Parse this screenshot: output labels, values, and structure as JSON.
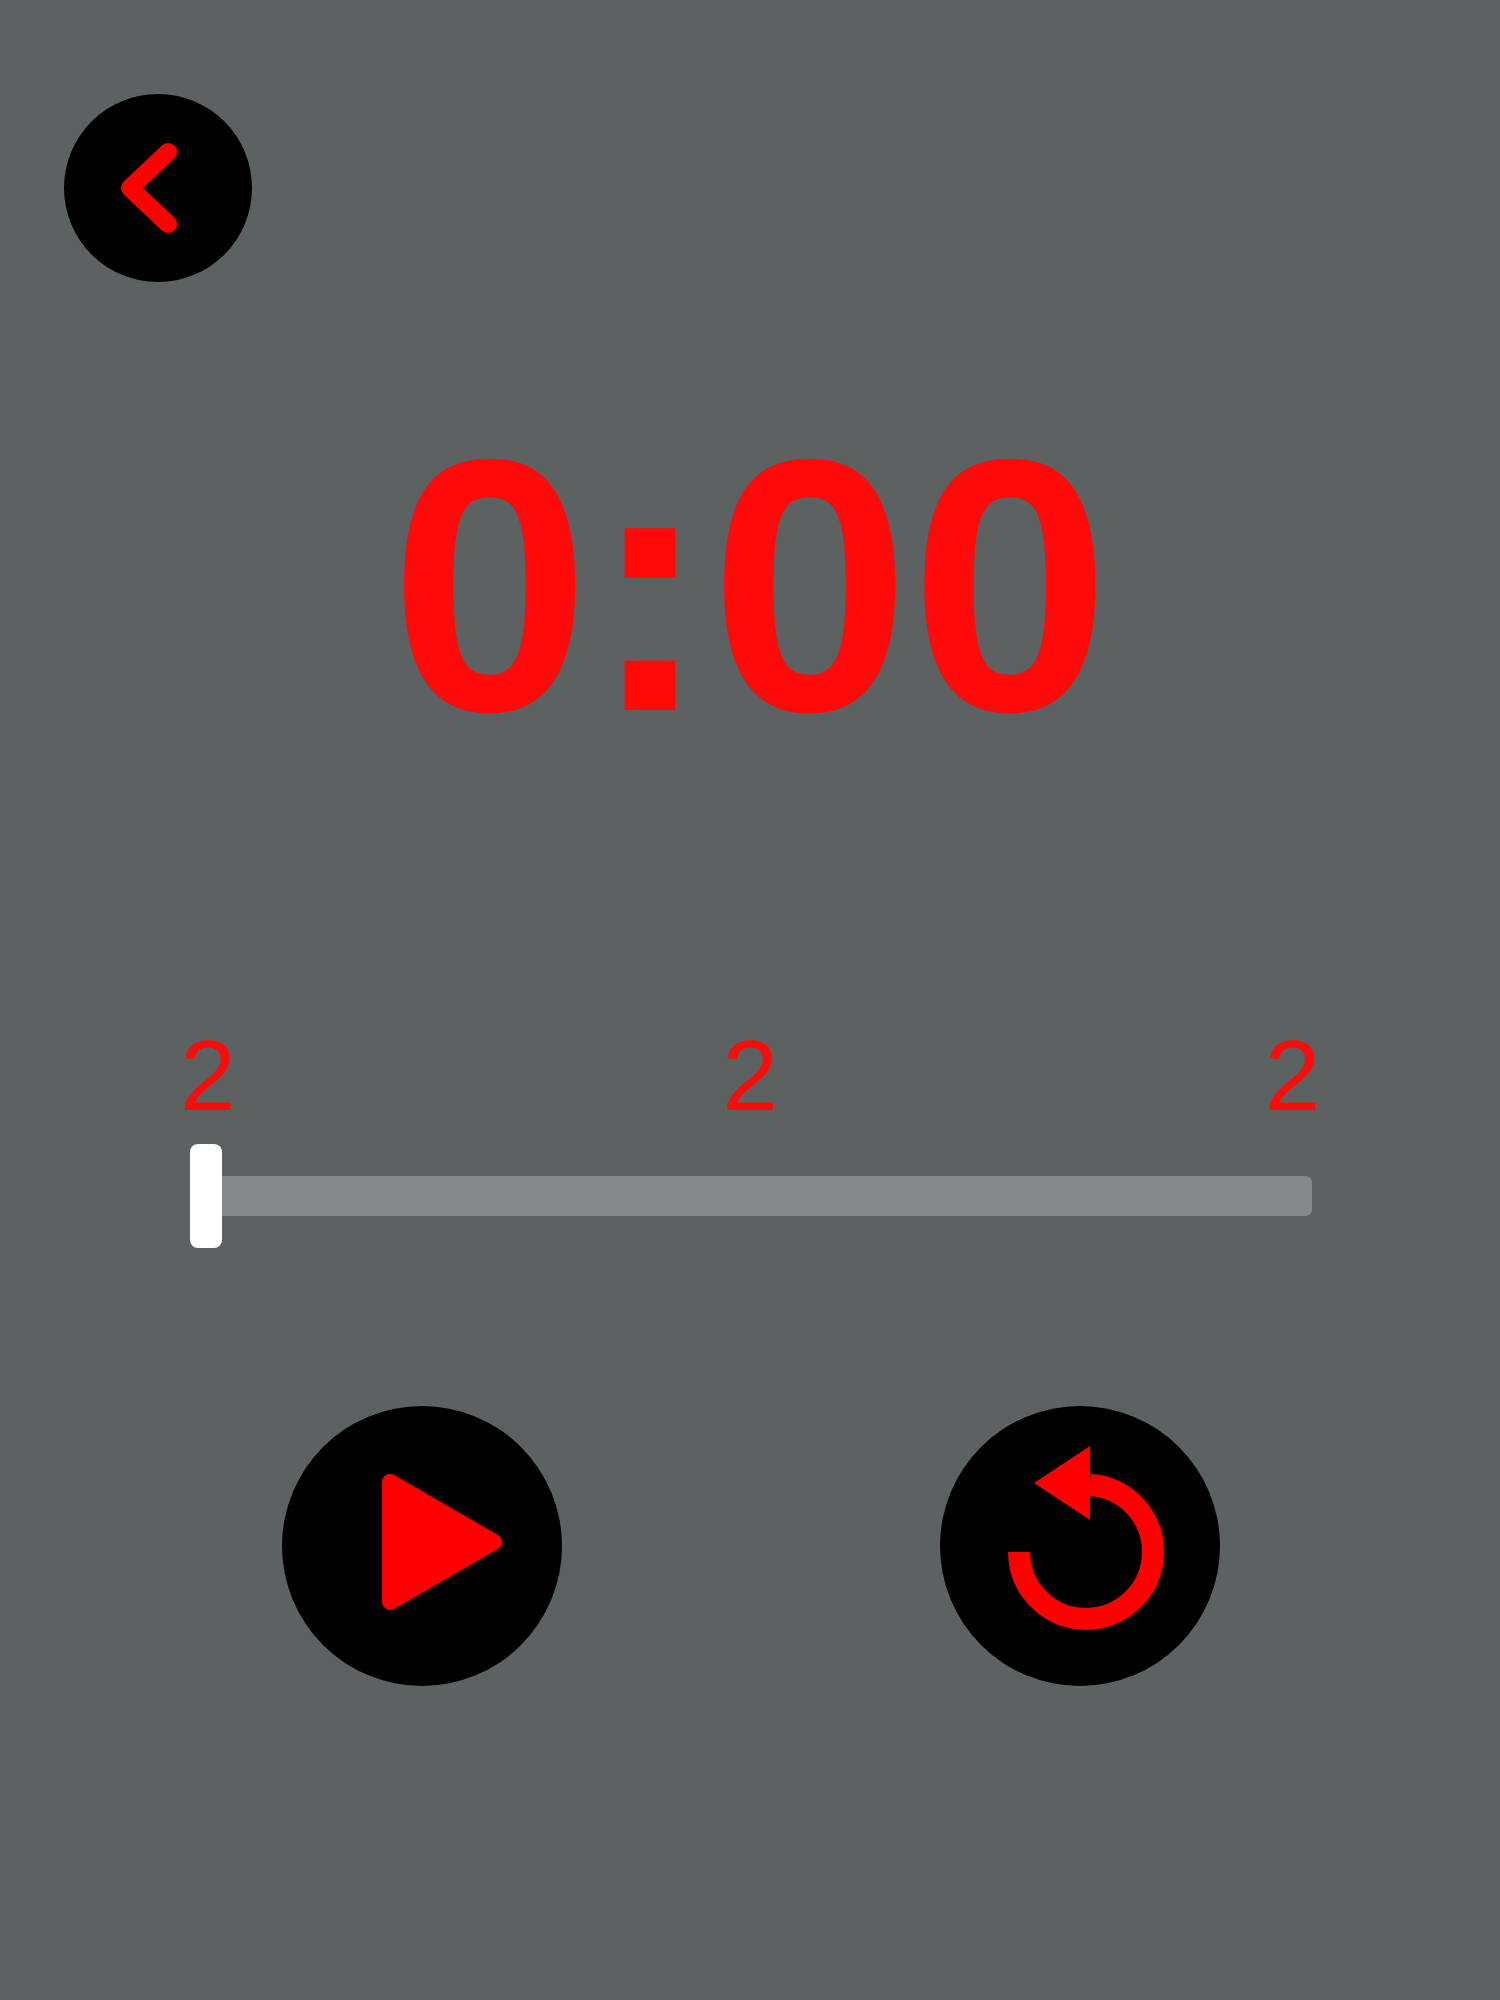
{
  "timer": {
    "time": "0:00"
  },
  "slider": {
    "labels": [
      "2",
      "2",
      "2"
    ],
    "level": 0
  },
  "controls": [
    {
      "kind": "play"
    },
    {
      "kind": "restart"
    }
  ]
}
